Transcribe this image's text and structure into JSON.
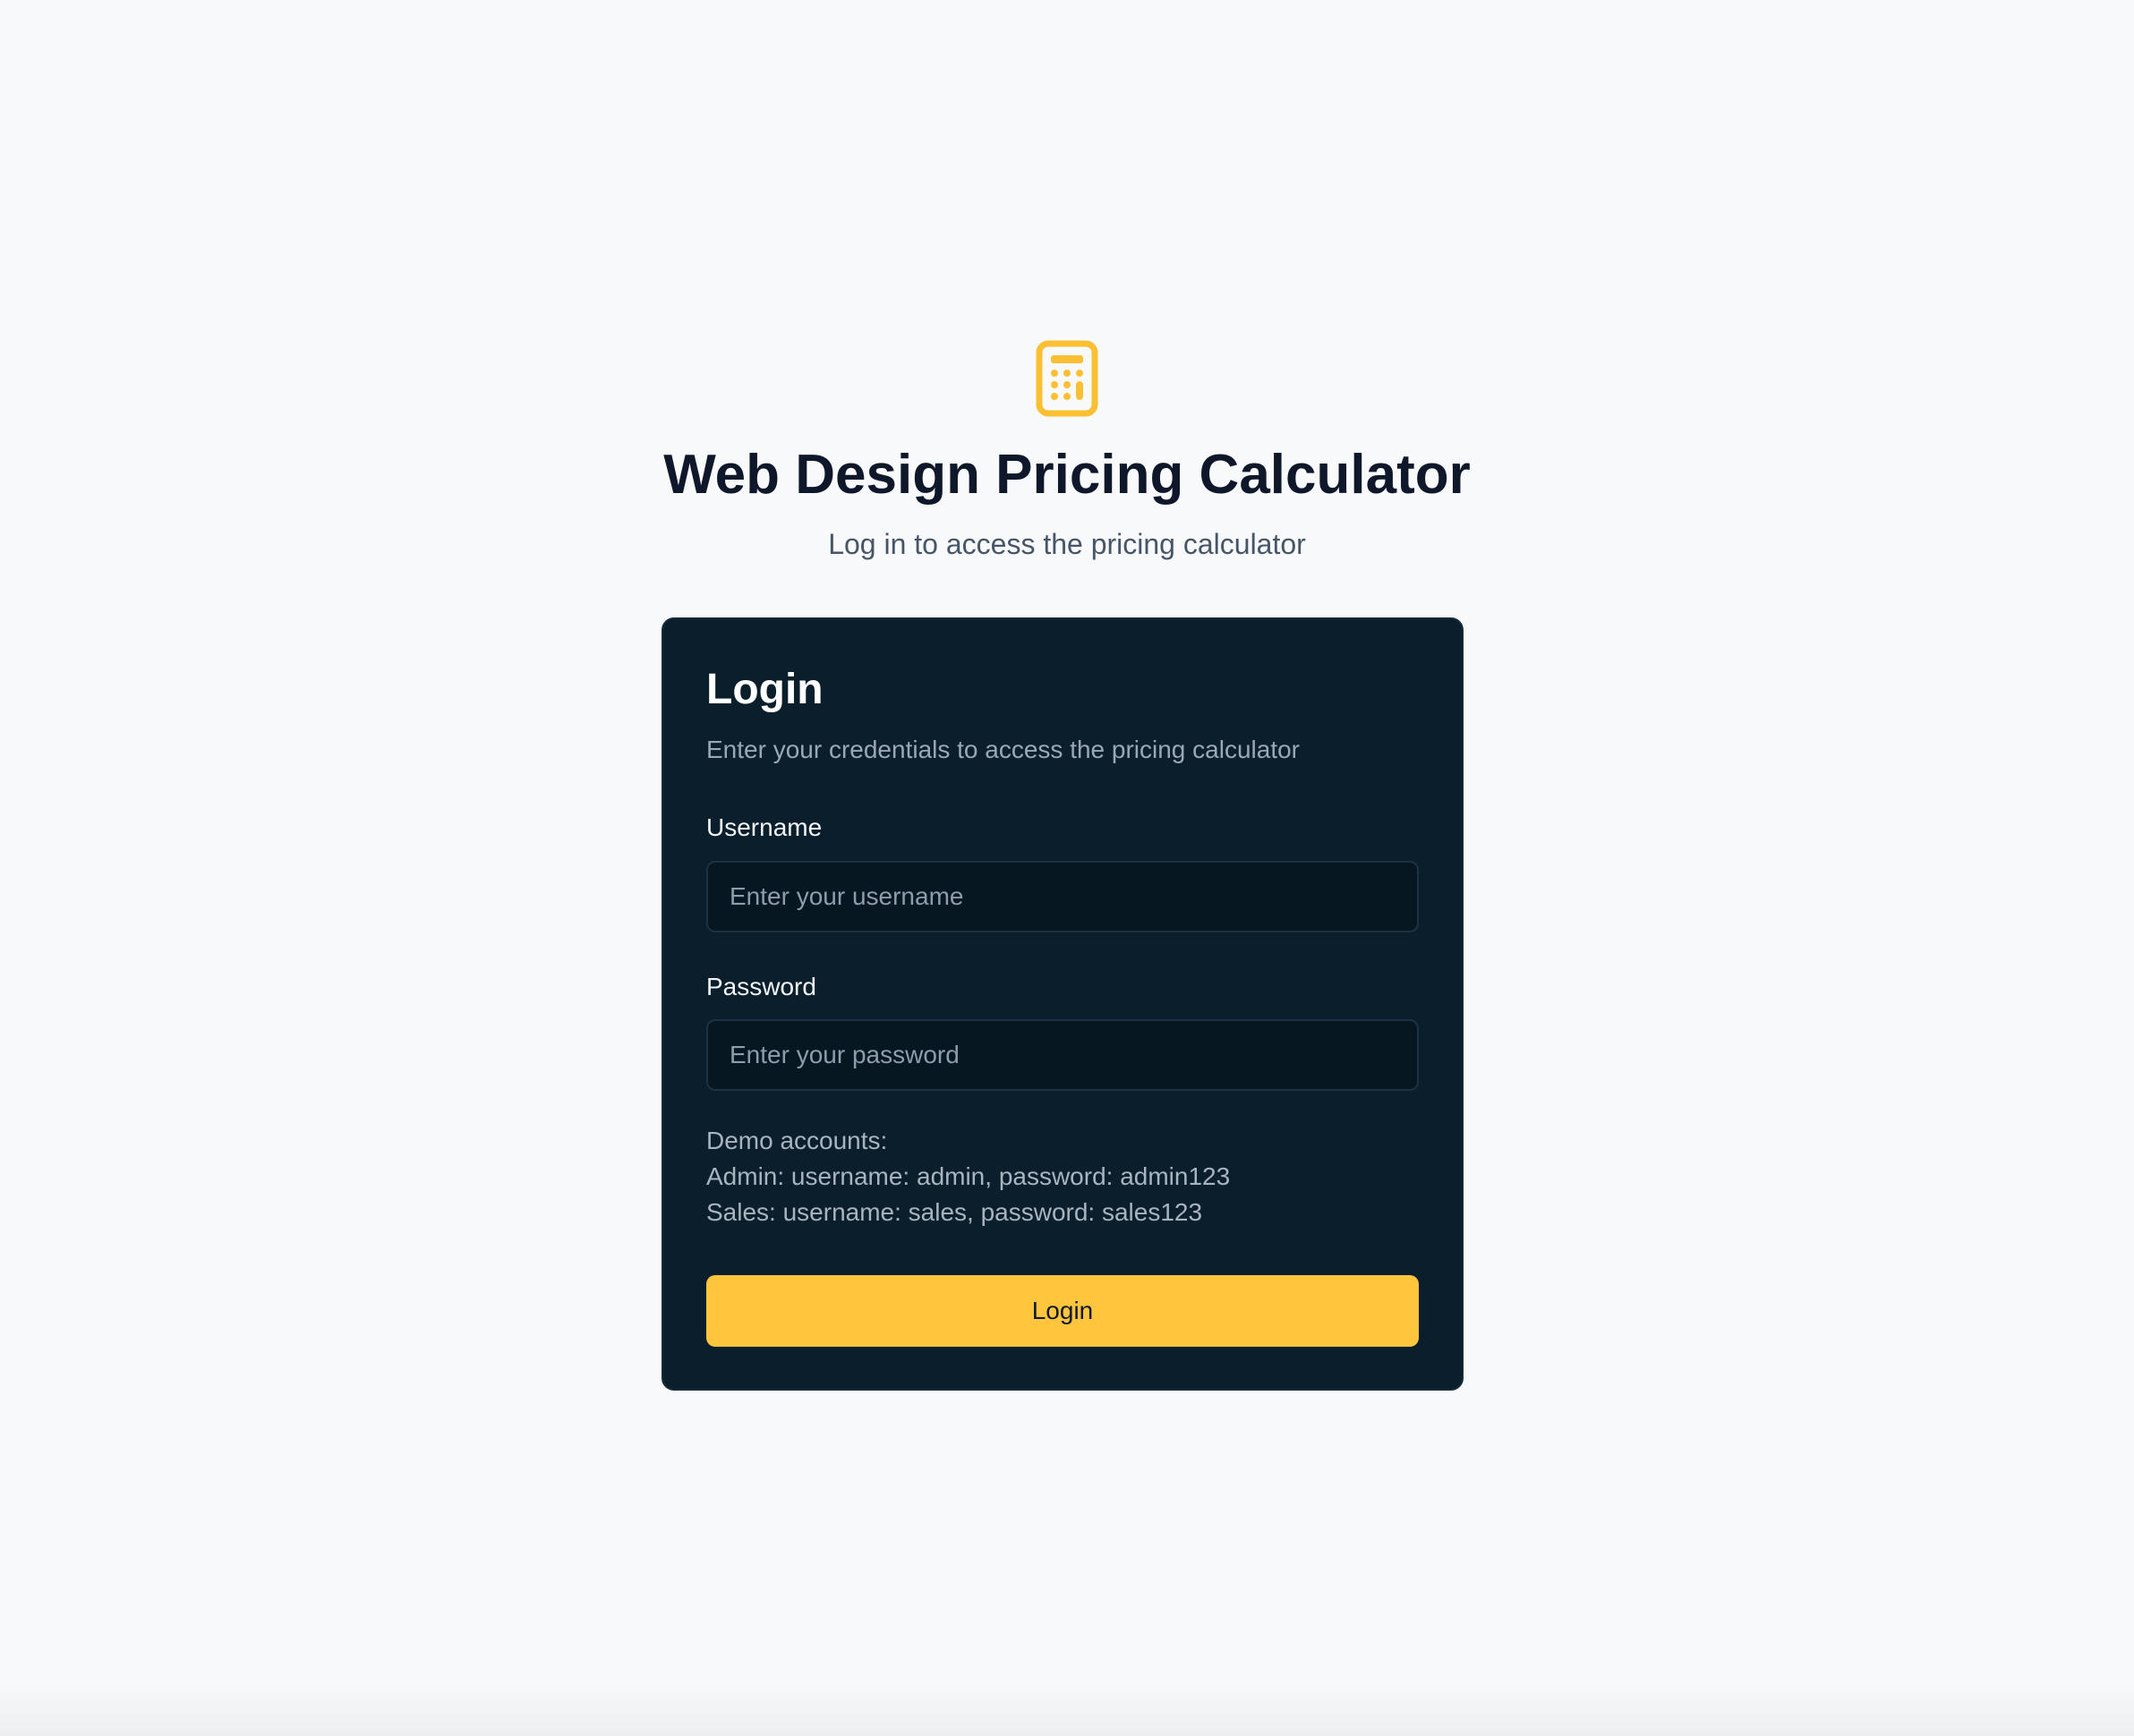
{
  "header": {
    "logo_icon": "calculator-icon",
    "title": "Web Design Pricing Calculator",
    "subtitle": "Log in to access the pricing calculator"
  },
  "login_card": {
    "title": "Login",
    "description": "Enter your credentials to access the pricing calculator",
    "username": {
      "label": "Username",
      "value": "",
      "placeholder": "Enter your username"
    },
    "password": {
      "label": "Password",
      "value": "",
      "placeholder": "Enter your password"
    },
    "demo_accounts": {
      "heading": "Demo accounts:",
      "lines": [
        "Admin: username: admin, password: admin123",
        "Sales: username: sales, password: sales123"
      ]
    },
    "submit_label": "Login"
  },
  "colors": {
    "page_background": "#f8f9fb",
    "card_background": "#0b1e2b",
    "accent": "#ffc53d",
    "title_text": "#0f172a"
  }
}
